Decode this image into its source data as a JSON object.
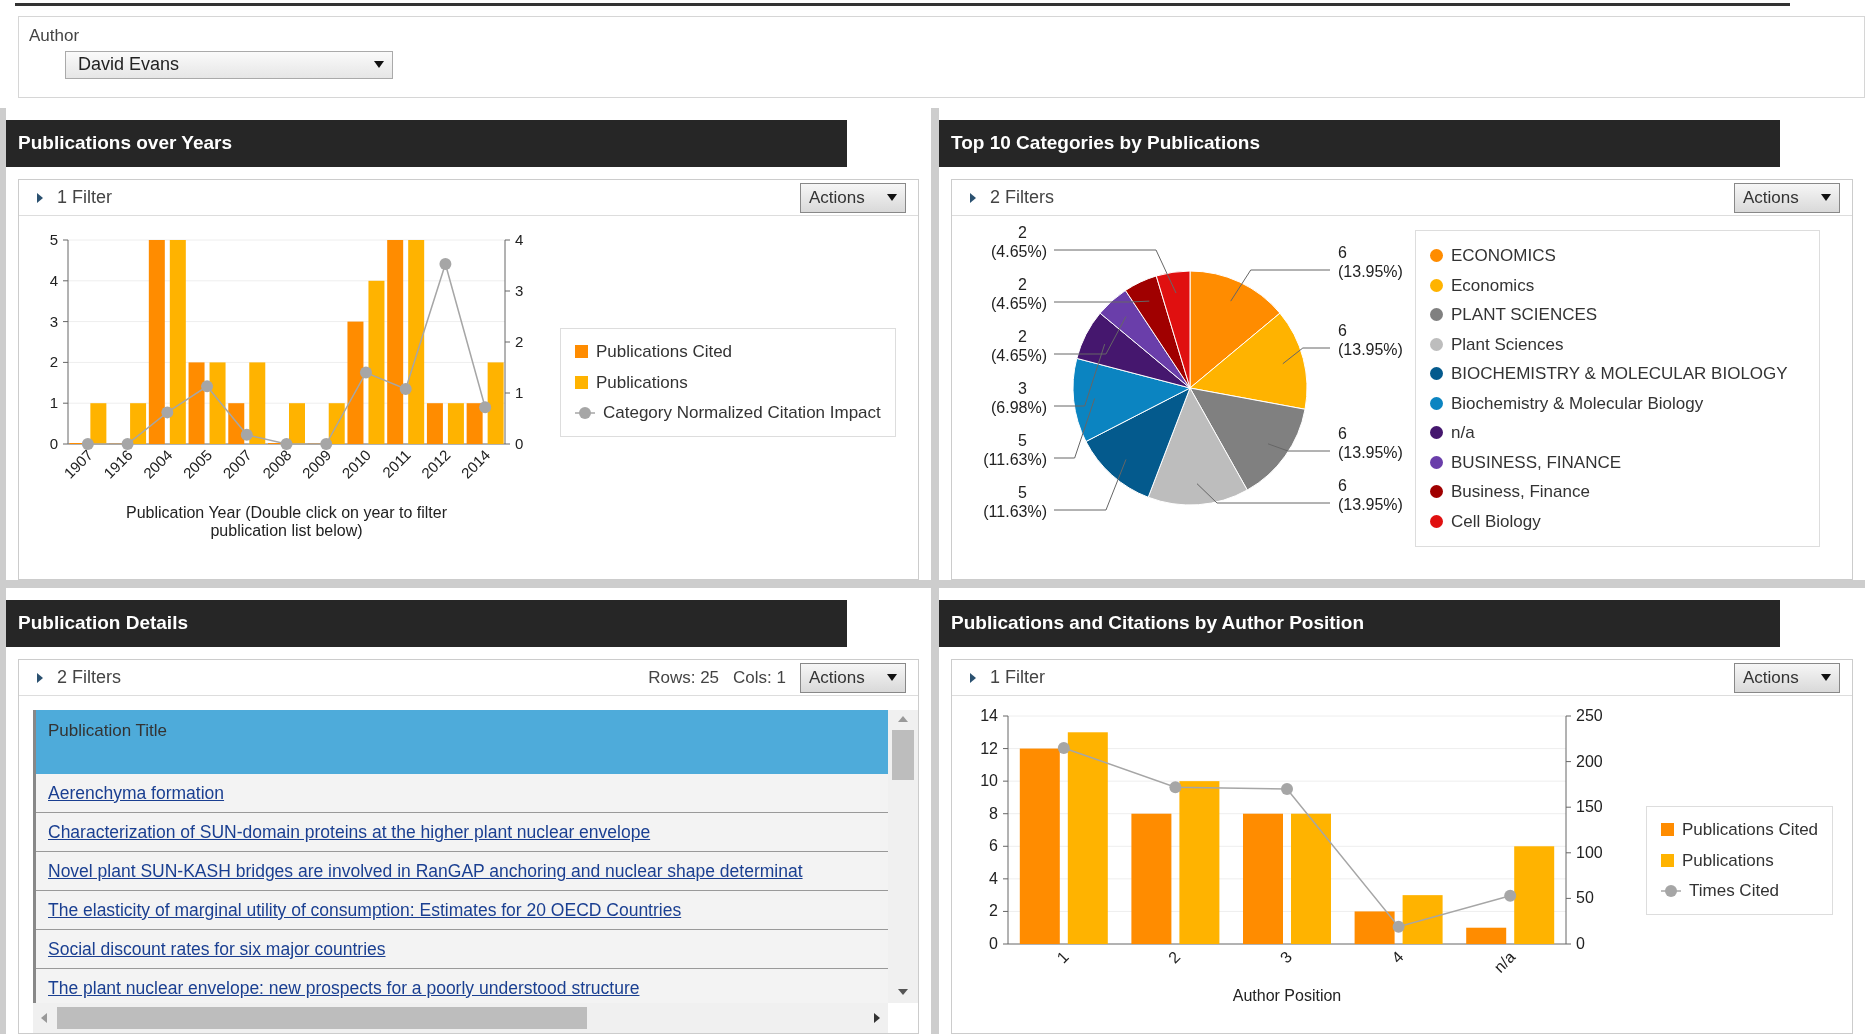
{
  "author_filter": {
    "label": "Author",
    "value": "David Evans"
  },
  "panels": [
    {
      "kind": "combo_chart",
      "title": "Publications over Years",
      "filter_label": "1 Filter",
      "actions": "Actions",
      "chart_data": {
        "type": "bar",
        "xlabel": "Publication Year (Double click on year to filter publication list below)",
        "categories": [
          "1907",
          "1916",
          "2004",
          "2005",
          "2007",
          "2008",
          "2009",
          "2010",
          "2011",
          "2012",
          "2014"
        ],
        "ylim": [
          0,
          5
        ],
        "yticks": [
          0,
          1,
          2,
          3,
          4,
          5
        ],
        "grid": true,
        "series": [
          {
            "name": "Publications Cited",
            "color": "#ff8c00",
            "values": [
              0,
              0,
              5,
              2,
              1,
              0,
              0,
              3,
              5,
              1,
              1
            ]
          },
          {
            "name": "Publications",
            "color": "#ffb300",
            "values": [
              1,
              1,
              5,
              2,
              2,
              1,
              1,
              4,
              5,
              1,
              2
            ]
          }
        ]
      },
      "line_overlay": {
        "chart_data": {
          "type": "line",
          "ylim": [
            0,
            4
          ],
          "yticks": [
            0,
            1,
            2,
            3,
            4
          ],
          "series": [
            {
              "name": "Category Normalized Citation Impact",
              "color": "#a6a6a6",
              "marker": "circle",
              "values": [
                0,
                0,
                0.62,
                1.13,
                0.18,
                0,
                0,
                1.4,
                1.08,
                3.53,
                0.72
              ]
            }
          ]
        }
      }
    },
    {
      "kind": "pie_chart",
      "title": "Top 10 Categories by Publications",
      "filter_label": "2 Filters",
      "actions": "Actions",
      "chart_data": {
        "type": "pie",
        "categories": [
          "ECONOMICS",
          "Economics",
          "PLANT SCIENCES",
          "Plant Sciences",
          "BIOCHEMISTRY & MOLECULAR BIOLOGY",
          "Biochemistry & Molecular Biology",
          "n/a",
          "BUSINESS, FINANCE",
          "Business, Finance",
          "Cell Biology"
        ],
        "values": [
          6,
          6,
          6,
          6,
          5,
          5,
          3,
          2,
          2,
          2
        ],
        "colors": [
          "#ff8c00",
          "#ffb300",
          "#808080",
          "#bdbdbd",
          "#045a8d",
          "#0b84c1",
          "#45176e",
          "#6a3eaa",
          "#a00000",
          "#e01010"
        ],
        "value_labels": [
          "6 (13.95%)",
          "6 (13.95%)",
          "6 (13.95%)",
          "6 (13.95%)",
          "5 (11.63%)",
          "5 (11.63%)",
          "3 (6.98%)",
          "2 (4.65%)",
          "2 (4.65%)",
          "2 (4.65%)"
        ]
      }
    },
    {
      "kind": "table",
      "title": "Publication Details",
      "filter_label": "2 Filters",
      "actions": "Actions",
      "rows_info": "Rows: 25",
      "cols_info": "Cols: 1",
      "columns": [
        "Publication Title"
      ],
      "rows": [
        {
          "title": "Aerenchyma formation"
        },
        {
          "title": "Characterization of SUN-domain proteins at the higher plant nuclear envelope"
        },
        {
          "title": "Novel plant SUN-KASH bridges are involved in RanGAP anchoring and nuclear shape determinat"
        },
        {
          "title": "The elasticity of marginal utility of consumption: Estimates for 20 OECD Countries"
        },
        {
          "title": "Social discount rates for six major countries"
        },
        {
          "title": "The plant nuclear envelope: new prospects for a poorly understood structure"
        }
      ]
    },
    {
      "kind": "combo_chart",
      "title": "Publications and Citations by Author Position",
      "filter_label": "1 Filter",
      "actions": "Actions",
      "chart_data": {
        "type": "bar",
        "xlabel": "Author Position",
        "categories": [
          "1",
          "2",
          "3",
          "4",
          "n/a"
        ],
        "ylim": [
          0,
          14
        ],
        "yticks": [
          0,
          2,
          4,
          6,
          8,
          10,
          12,
          14
        ],
        "grid": true,
        "series": [
          {
            "name": "Publications Cited",
            "color": "#ff8c00",
            "values": [
              12,
              8,
              8,
              2,
              1
            ]
          },
          {
            "name": "Publications",
            "color": "#ffb300",
            "values": [
              13,
              10,
              8,
              3,
              6
            ]
          }
        ]
      },
      "line_overlay": {
        "chart_data": {
          "type": "line",
          "ylim": [
            0,
            250
          ],
          "yticks": [
            0,
            50,
            100,
            150,
            200,
            250
          ],
          "series": [
            {
              "name": "Times Cited",
              "color": "#a6a6a6",
              "marker": "circle",
              "values": [
                215,
                172,
                170,
                19,
                53
              ]
            }
          ]
        }
      }
    }
  ]
}
